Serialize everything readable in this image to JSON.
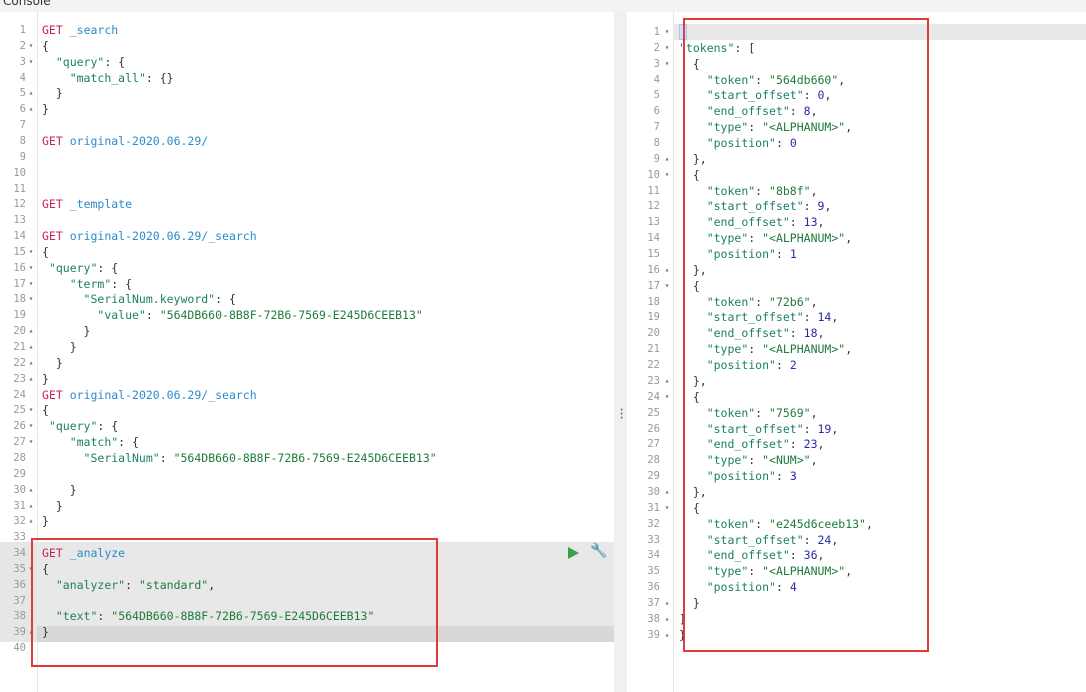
{
  "tabs": [
    {
      "label": "Console"
    }
  ],
  "left_editor": {
    "lines": [
      {
        "n": "1",
        "fold": "",
        "tokens": [
          [
            "m",
            "GET"
          ],
          [
            "p",
            " "
          ],
          [
            "u",
            "_search"
          ]
        ]
      },
      {
        "n": "2",
        "fold": "▾",
        "tokens": [
          [
            "p",
            "{"
          ]
        ]
      },
      {
        "n": "3",
        "fold": "▾",
        "tokens": [
          [
            "p",
            "  "
          ],
          [
            "k",
            "\"query\""
          ],
          [
            "p",
            ": {"
          ]
        ]
      },
      {
        "n": "4",
        "fold": "",
        "tokens": [
          [
            "p",
            "    "
          ],
          [
            "k",
            "\"match_all\""
          ],
          [
            "p",
            ": {}"
          ]
        ]
      },
      {
        "n": "5",
        "fold": "▴",
        "tokens": [
          [
            "p",
            "  }"
          ]
        ]
      },
      {
        "n": "6",
        "fold": "▴",
        "tokens": [
          [
            "p",
            "}"
          ]
        ]
      },
      {
        "n": "7",
        "fold": "",
        "tokens": []
      },
      {
        "n": "8",
        "fold": "",
        "tokens": [
          [
            "m",
            "GET"
          ],
          [
            "p",
            " "
          ],
          [
            "u",
            "original-2020.06.29/"
          ]
        ]
      },
      {
        "n": "9",
        "fold": "",
        "tokens": []
      },
      {
        "n": "10",
        "fold": "",
        "tokens": []
      },
      {
        "n": "11",
        "fold": "",
        "tokens": []
      },
      {
        "n": "12",
        "fold": "",
        "tokens": [
          [
            "m",
            "GET"
          ],
          [
            "p",
            " "
          ],
          [
            "u",
            "_template"
          ]
        ]
      },
      {
        "n": "13",
        "fold": "",
        "tokens": []
      },
      {
        "n": "14",
        "fold": "",
        "tokens": [
          [
            "m",
            "GET"
          ],
          [
            "p",
            " "
          ],
          [
            "u",
            "original-2020.06.29/_search"
          ]
        ]
      },
      {
        "n": "15",
        "fold": "▾",
        "tokens": [
          [
            "p",
            "{"
          ]
        ]
      },
      {
        "n": "16",
        "fold": "▾",
        "tokens": [
          [
            "p",
            " "
          ],
          [
            "k",
            "\"query\""
          ],
          [
            "p",
            ": {"
          ]
        ]
      },
      {
        "n": "17",
        "fold": "▾",
        "tokens": [
          [
            "p",
            "    "
          ],
          [
            "k",
            "\"term\""
          ],
          [
            "p",
            ": {"
          ]
        ]
      },
      {
        "n": "18",
        "fold": "▾",
        "tokens": [
          [
            "p",
            "      "
          ],
          [
            "k",
            "\"SerialNum.keyword\""
          ],
          [
            "p",
            ": {"
          ]
        ]
      },
      {
        "n": "19",
        "fold": "",
        "tokens": [
          [
            "p",
            "        "
          ],
          [
            "k",
            "\"value\""
          ],
          [
            "p",
            ": "
          ],
          [
            "s",
            "\"564DB660-8B8F-72B6-7569-E245D6CEEB13\""
          ]
        ]
      },
      {
        "n": "20",
        "fold": "▴",
        "tokens": [
          [
            "p",
            "      }"
          ]
        ]
      },
      {
        "n": "21",
        "fold": "▴",
        "tokens": [
          [
            "p",
            "    }"
          ]
        ]
      },
      {
        "n": "22",
        "fold": "▴",
        "tokens": [
          [
            "p",
            "  }"
          ]
        ]
      },
      {
        "n": "23",
        "fold": "▴",
        "tokens": [
          [
            "p",
            "}"
          ]
        ]
      },
      {
        "n": "24",
        "fold": "",
        "tokens": [
          [
            "m",
            "GET"
          ],
          [
            "p",
            " "
          ],
          [
            "u",
            "original-2020.06.29/_search"
          ]
        ]
      },
      {
        "n": "25",
        "fold": "▾",
        "tokens": [
          [
            "p",
            "{"
          ]
        ]
      },
      {
        "n": "26",
        "fold": "▾",
        "tokens": [
          [
            "p",
            " "
          ],
          [
            "k",
            "\"query\""
          ],
          [
            "p",
            ": {"
          ]
        ]
      },
      {
        "n": "27",
        "fold": "▾",
        "tokens": [
          [
            "p",
            "    "
          ],
          [
            "k",
            "\"match\""
          ],
          [
            "p",
            ": {"
          ]
        ]
      },
      {
        "n": "28",
        "fold": "",
        "tokens": [
          [
            "p",
            "      "
          ],
          [
            "k",
            "\"SerialNum\""
          ],
          [
            "p",
            ": "
          ],
          [
            "s",
            "\"564DB660-8B8F-72B6-7569-E245D6CEEB13\""
          ]
        ]
      },
      {
        "n": "29",
        "fold": "",
        "tokens": []
      },
      {
        "n": "30",
        "fold": "▴",
        "tokens": [
          [
            "p",
            "    }"
          ]
        ]
      },
      {
        "n": "31",
        "fold": "▴",
        "tokens": [
          [
            "p",
            "  }"
          ]
        ]
      },
      {
        "n": "32",
        "fold": "▴",
        "tokens": [
          [
            "p",
            "}"
          ]
        ]
      },
      {
        "n": "33",
        "fold": "",
        "tokens": []
      },
      {
        "n": "34",
        "fold": "",
        "tokens": [
          [
            "m",
            "GET"
          ],
          [
            "p",
            " "
          ],
          [
            "u",
            "_analyze"
          ]
        ]
      },
      {
        "n": "35",
        "fold": "▾",
        "tokens": [
          [
            "p",
            "{"
          ]
        ]
      },
      {
        "n": "36",
        "fold": "",
        "tokens": [
          [
            "p",
            "  "
          ],
          [
            "k",
            "\"analyzer\""
          ],
          [
            "p",
            ": "
          ],
          [
            "s",
            "\"standard\""
          ],
          [
            "p",
            ","
          ]
        ]
      },
      {
        "n": "37",
        "fold": "",
        "tokens": []
      },
      {
        "n": "38",
        "fold": "",
        "tokens": [
          [
            "p",
            "  "
          ],
          [
            "k",
            "\"text\""
          ],
          [
            "p",
            ": "
          ],
          [
            "s",
            "\"564DB660-8B8F-72B6-7569-E245D6CEEB13\""
          ]
        ]
      },
      {
        "n": "39",
        "fold": "▴",
        "tokens": [
          [
            "p",
            "}"
          ]
        ]
      },
      {
        "n": "40",
        "fold": "",
        "tokens": []
      }
    ]
  },
  "right_editor": {
    "lines": [
      {
        "n": "1",
        "fold": "▾",
        "tokens": [
          [
            "p",
            "{"
          ]
        ]
      },
      {
        "n": "2",
        "fold": "▾",
        "tokens": [
          [
            "k",
            "\"tokens\""
          ],
          [
            "p",
            ": ["
          ]
        ]
      },
      {
        "n": "3",
        "fold": "▾",
        "tokens": [
          [
            "p",
            "  {"
          ]
        ]
      },
      {
        "n": "4",
        "fold": "",
        "tokens": [
          [
            "p",
            "    "
          ],
          [
            "k",
            "\"token\""
          ],
          [
            "p",
            ": "
          ],
          [
            "s",
            "\"564db660\""
          ],
          [
            "p",
            ","
          ]
        ]
      },
      {
        "n": "5",
        "fold": "",
        "tokens": [
          [
            "p",
            "    "
          ],
          [
            "k",
            "\"start_offset\""
          ],
          [
            "p",
            ": "
          ],
          [
            "n",
            "0"
          ],
          [
            "p",
            ","
          ]
        ]
      },
      {
        "n": "6",
        "fold": "",
        "tokens": [
          [
            "p",
            "    "
          ],
          [
            "k",
            "\"end_offset\""
          ],
          [
            "p",
            ": "
          ],
          [
            "n",
            "8"
          ],
          [
            "p",
            ","
          ]
        ]
      },
      {
        "n": "7",
        "fold": "",
        "tokens": [
          [
            "p",
            "    "
          ],
          [
            "k",
            "\"type\""
          ],
          [
            "p",
            ": "
          ],
          [
            "s",
            "\"<ALPHANUM>\""
          ],
          [
            "p",
            ","
          ]
        ]
      },
      {
        "n": "8",
        "fold": "",
        "tokens": [
          [
            "p",
            "    "
          ],
          [
            "k",
            "\"position\""
          ],
          [
            "p",
            ": "
          ],
          [
            "n",
            "0"
          ]
        ]
      },
      {
        "n": "9",
        "fold": "▴",
        "tokens": [
          [
            "p",
            "  },"
          ]
        ]
      },
      {
        "n": "10",
        "fold": "▾",
        "tokens": [
          [
            "p",
            "  {"
          ]
        ]
      },
      {
        "n": "11",
        "fold": "",
        "tokens": [
          [
            "p",
            "    "
          ],
          [
            "k",
            "\"token\""
          ],
          [
            "p",
            ": "
          ],
          [
            "s",
            "\"8b8f\""
          ],
          [
            "p",
            ","
          ]
        ]
      },
      {
        "n": "12",
        "fold": "",
        "tokens": [
          [
            "p",
            "    "
          ],
          [
            "k",
            "\"start_offset\""
          ],
          [
            "p",
            ": "
          ],
          [
            "n",
            "9"
          ],
          [
            "p",
            ","
          ]
        ]
      },
      {
        "n": "13",
        "fold": "",
        "tokens": [
          [
            "p",
            "    "
          ],
          [
            "k",
            "\"end_offset\""
          ],
          [
            "p",
            ": "
          ],
          [
            "n",
            "13"
          ],
          [
            "p",
            ","
          ]
        ]
      },
      {
        "n": "14",
        "fold": "",
        "tokens": [
          [
            "p",
            "    "
          ],
          [
            "k",
            "\"type\""
          ],
          [
            "p",
            ": "
          ],
          [
            "s",
            "\"<ALPHANUM>\""
          ],
          [
            "p",
            ","
          ]
        ]
      },
      {
        "n": "15",
        "fold": "",
        "tokens": [
          [
            "p",
            "    "
          ],
          [
            "k",
            "\"position\""
          ],
          [
            "p",
            ": "
          ],
          [
            "n",
            "1"
          ]
        ]
      },
      {
        "n": "16",
        "fold": "▴",
        "tokens": [
          [
            "p",
            "  },"
          ]
        ]
      },
      {
        "n": "17",
        "fold": "▾",
        "tokens": [
          [
            "p",
            "  {"
          ]
        ]
      },
      {
        "n": "18",
        "fold": "",
        "tokens": [
          [
            "p",
            "    "
          ],
          [
            "k",
            "\"token\""
          ],
          [
            "p",
            ": "
          ],
          [
            "s",
            "\"72b6\""
          ],
          [
            "p",
            ","
          ]
        ]
      },
      {
        "n": "19",
        "fold": "",
        "tokens": [
          [
            "p",
            "    "
          ],
          [
            "k",
            "\"start_offset\""
          ],
          [
            "p",
            ": "
          ],
          [
            "n",
            "14"
          ],
          [
            "p",
            ","
          ]
        ]
      },
      {
        "n": "20",
        "fold": "",
        "tokens": [
          [
            "p",
            "    "
          ],
          [
            "k",
            "\"end_offset\""
          ],
          [
            "p",
            ": "
          ],
          [
            "n",
            "18"
          ],
          [
            "p",
            ","
          ]
        ]
      },
      {
        "n": "21",
        "fold": "",
        "tokens": [
          [
            "p",
            "    "
          ],
          [
            "k",
            "\"type\""
          ],
          [
            "p",
            ": "
          ],
          [
            "s",
            "\"<ALPHANUM>\""
          ],
          [
            "p",
            ","
          ]
        ]
      },
      {
        "n": "22",
        "fold": "",
        "tokens": [
          [
            "p",
            "    "
          ],
          [
            "k",
            "\"position\""
          ],
          [
            "p",
            ": "
          ],
          [
            "n",
            "2"
          ]
        ]
      },
      {
        "n": "23",
        "fold": "▴",
        "tokens": [
          [
            "p",
            "  },"
          ]
        ]
      },
      {
        "n": "24",
        "fold": "▾",
        "tokens": [
          [
            "p",
            "  {"
          ]
        ]
      },
      {
        "n": "25",
        "fold": "",
        "tokens": [
          [
            "p",
            "    "
          ],
          [
            "k",
            "\"token\""
          ],
          [
            "p",
            ": "
          ],
          [
            "s",
            "\"7569\""
          ],
          [
            "p",
            ","
          ]
        ]
      },
      {
        "n": "26",
        "fold": "",
        "tokens": [
          [
            "p",
            "    "
          ],
          [
            "k",
            "\"start_offset\""
          ],
          [
            "p",
            ": "
          ],
          [
            "n",
            "19"
          ],
          [
            "p",
            ","
          ]
        ]
      },
      {
        "n": "27",
        "fold": "",
        "tokens": [
          [
            "p",
            "    "
          ],
          [
            "k",
            "\"end_offset\""
          ],
          [
            "p",
            ": "
          ],
          [
            "n",
            "23"
          ],
          [
            "p",
            ","
          ]
        ]
      },
      {
        "n": "28",
        "fold": "",
        "tokens": [
          [
            "p",
            "    "
          ],
          [
            "k",
            "\"type\""
          ],
          [
            "p",
            ": "
          ],
          [
            "s",
            "\"<NUM>\""
          ],
          [
            "p",
            ","
          ]
        ]
      },
      {
        "n": "29",
        "fold": "",
        "tokens": [
          [
            "p",
            "    "
          ],
          [
            "k",
            "\"position\""
          ],
          [
            "p",
            ": "
          ],
          [
            "n",
            "3"
          ]
        ]
      },
      {
        "n": "30",
        "fold": "▴",
        "tokens": [
          [
            "p",
            "  },"
          ]
        ]
      },
      {
        "n": "31",
        "fold": "▾",
        "tokens": [
          [
            "p",
            "  {"
          ]
        ]
      },
      {
        "n": "32",
        "fold": "",
        "tokens": [
          [
            "p",
            "    "
          ],
          [
            "k",
            "\"token\""
          ],
          [
            "p",
            ": "
          ],
          [
            "s",
            "\"e245d6ceeb13\""
          ],
          [
            "p",
            ","
          ]
        ]
      },
      {
        "n": "33",
        "fold": "",
        "tokens": [
          [
            "p",
            "    "
          ],
          [
            "k",
            "\"start_offset\""
          ],
          [
            "p",
            ": "
          ],
          [
            "n",
            "24"
          ],
          [
            "p",
            ","
          ]
        ]
      },
      {
        "n": "34",
        "fold": "",
        "tokens": [
          [
            "p",
            "    "
          ],
          [
            "k",
            "\"end_offset\""
          ],
          [
            "p",
            ": "
          ],
          [
            "n",
            "36"
          ],
          [
            "p",
            ","
          ]
        ]
      },
      {
        "n": "35",
        "fold": "",
        "tokens": [
          [
            "p",
            "    "
          ],
          [
            "k",
            "\"type\""
          ],
          [
            "p",
            ": "
          ],
          [
            "s",
            "\"<ALPHANUM>\""
          ],
          [
            "p",
            ","
          ]
        ]
      },
      {
        "n": "36",
        "fold": "",
        "tokens": [
          [
            "p",
            "    "
          ],
          [
            "k",
            "\"position\""
          ],
          [
            "p",
            ": "
          ],
          [
            "n",
            "4"
          ]
        ]
      },
      {
        "n": "37",
        "fold": "▴",
        "tokens": [
          [
            "p",
            "  }"
          ]
        ]
      },
      {
        "n": "38",
        "fold": "▴",
        "tokens": [
          [
            "p",
            "]"
          ]
        ]
      },
      {
        "n": "39",
        "fold": "▴",
        "tokens": [
          [
            "p",
            "}"
          ]
        ]
      }
    ]
  },
  "actions": {
    "run_icon": "play-icon",
    "settings_icon": "wrench-icon"
  },
  "colors": {
    "method": "#c7254e",
    "url": "#2a8bc9",
    "key": "#1a7f6a",
    "string": "#1e7b3b",
    "number": "#2b2ba8",
    "highlight_box": "#e03a3a",
    "run": "#3aa04a"
  }
}
